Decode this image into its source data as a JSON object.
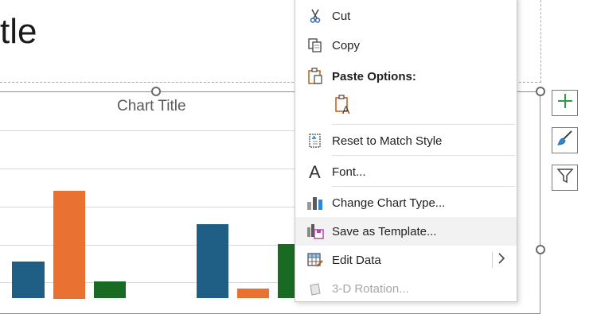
{
  "slide": {
    "title_fragment": "tle"
  },
  "chart": {
    "title": "Chart Title",
    "colors": {
      "series1": "#1f5f85",
      "series2": "#e97132",
      "series3": "#196b24"
    }
  },
  "context_menu": {
    "items": [
      {
        "id": "cut",
        "label": "Cut",
        "icon": "scissors-icon"
      },
      {
        "id": "copy",
        "label": "Copy",
        "icon": "copy-icon"
      },
      {
        "id": "paste_options",
        "label": "Paste Options:",
        "icon": "paste-icon"
      },
      {
        "id": "paste_keep_text",
        "label": "",
        "icon": "paste-keep-text-only-icon"
      },
      {
        "id": "reset_style",
        "label": "Reset to Match Style",
        "icon": "reset-style-icon"
      },
      {
        "id": "font",
        "label": "Font...",
        "icon": "font-icon"
      },
      {
        "id": "change_chart_type",
        "label": "Change Chart Type...",
        "icon": "chart-type-icon"
      },
      {
        "id": "save_template",
        "label": "Save as Template...",
        "icon": "save-template-icon"
      },
      {
        "id": "edit_data",
        "label": "Edit Data",
        "icon": "edit-data-icon"
      },
      {
        "id": "rotation_3d",
        "label": "3-D Rotation...",
        "icon": "rotation-3d-icon"
      }
    ]
  },
  "side_buttons": [
    {
      "id": "chart_elements",
      "icon": "plus-icon"
    },
    {
      "id": "chart_styles",
      "icon": "brush-icon"
    },
    {
      "id": "chart_filters",
      "icon": "filter-icon"
    }
  ]
}
